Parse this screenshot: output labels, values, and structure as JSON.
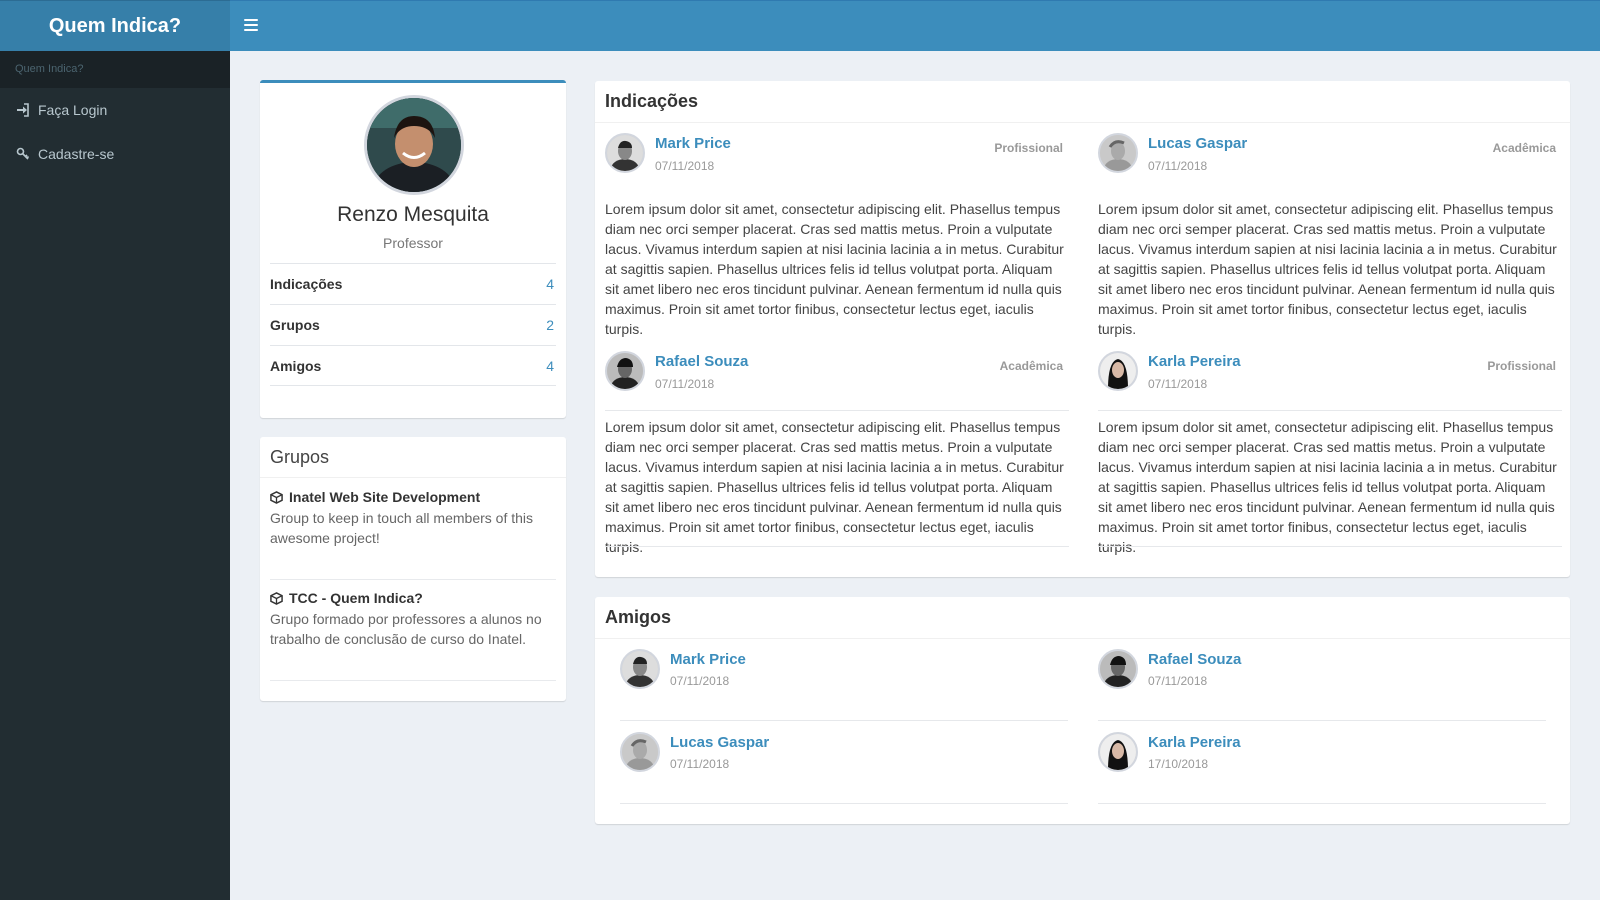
{
  "app": {
    "brand": "Quem Indica?"
  },
  "sidebar": {
    "header": "Quem Indica?",
    "items": [
      {
        "label": "Faça Login",
        "icon": "sign-in-icon"
      },
      {
        "label": "Cadastre-se",
        "icon": "key-icon"
      }
    ]
  },
  "profile": {
    "name": "Renzo Mesquita",
    "role": "Professor",
    "stats": [
      {
        "label": "Indicações",
        "value": "4"
      },
      {
        "label": "Grupos",
        "value": "2"
      },
      {
        "label": "Amigos",
        "value": "4"
      }
    ]
  },
  "groups": {
    "title": "Grupos",
    "items": [
      {
        "name": "Inatel Web Site Development",
        "description": "Group to keep in touch all members of this awesome project!"
      },
      {
        "name": "TCC - Quem Indica?",
        "description": "Grupo formado por professores a alunos no trabalho de conclusão de curso do Inatel."
      }
    ]
  },
  "recommendations": {
    "title": "Indicações",
    "items": [
      {
        "name": "Mark Price",
        "date": "07/11/2018",
        "tag": "Profissional",
        "text": "Lorem ipsum dolor sit amet, consectetur adipiscing elit. Phasellus tempus diam nec orci semper placerat. Cras sed mattis metus. Proin a vulputate lacus. Vivamus interdum sapien at nisi lacinia lacinia a in metus. Curabitur at sagittis sapien. Phasellus ultrices felis id tellus volutpat porta. Aliquam sit amet libero nec eros tincidunt pulvinar. Aenean fermentum id nulla quis maximus. Proin sit amet tortor finibus, consectetur lectus eget, iaculis turpis."
      },
      {
        "name": "Lucas Gaspar",
        "date": "07/11/2018",
        "tag": "Acadêmica",
        "text": "Lorem ipsum dolor sit amet, consectetur adipiscing elit. Phasellus tempus diam nec orci semper placerat. Cras sed mattis metus. Proin a vulputate lacus. Vivamus interdum sapien at nisi lacinia lacinia a in metus. Curabitur at sagittis sapien. Phasellus ultrices felis id tellus volutpat porta. Aliquam sit amet libero nec eros tincidunt pulvinar. Aenean fermentum id nulla quis maximus. Proin sit amet tortor finibus, consectetur lectus eget, iaculis turpis."
      },
      {
        "name": "Rafael Souza",
        "date": "07/11/2018",
        "tag": "Acadêmica",
        "text": "Lorem ipsum dolor sit amet, consectetur adipiscing elit. Phasellus tempus diam nec orci semper placerat. Cras sed mattis metus. Proin a vulputate lacus. Vivamus interdum sapien at nisi lacinia lacinia a in metus. Curabitur at sagittis sapien. Phasellus ultrices felis id tellus volutpat porta. Aliquam sit amet libero nec eros tincidunt pulvinar. Aenean fermentum id nulla quis maximus. Proin sit amet tortor finibus, consectetur lectus eget, iaculis turpis."
      },
      {
        "name": "Karla Pereira",
        "date": "07/11/2018",
        "tag": "Profissional",
        "text": "Lorem ipsum dolor sit amet, consectetur adipiscing elit. Phasellus tempus diam nec orci semper placerat. Cras sed mattis metus. Proin a vulputate lacus. Vivamus interdum sapien at nisi lacinia lacinia a in metus. Curabitur at sagittis sapien. Phasellus ultrices felis id tellus volutpat porta. Aliquam sit amet libero nec eros tincidunt pulvinar. Aenean fermentum id nulla quis maximus. Proin sit amet tortor finibus, consectetur lectus eget, iaculis turpis."
      }
    ]
  },
  "friends": {
    "title": "Amigos",
    "items": [
      {
        "name": "Mark Price",
        "date": "07/11/2018"
      },
      {
        "name": "Rafael Souza",
        "date": "07/11/2018"
      },
      {
        "name": "Lucas Gaspar",
        "date": "07/11/2018"
      },
      {
        "name": "Karla Pereira",
        "date": "17/10/2018"
      }
    ]
  },
  "colors": {
    "brand": "#367fa9",
    "header": "#3c8dbc",
    "sidebar": "#222d32",
    "link": "#3c8dbc",
    "background": "#ecf0f5"
  }
}
